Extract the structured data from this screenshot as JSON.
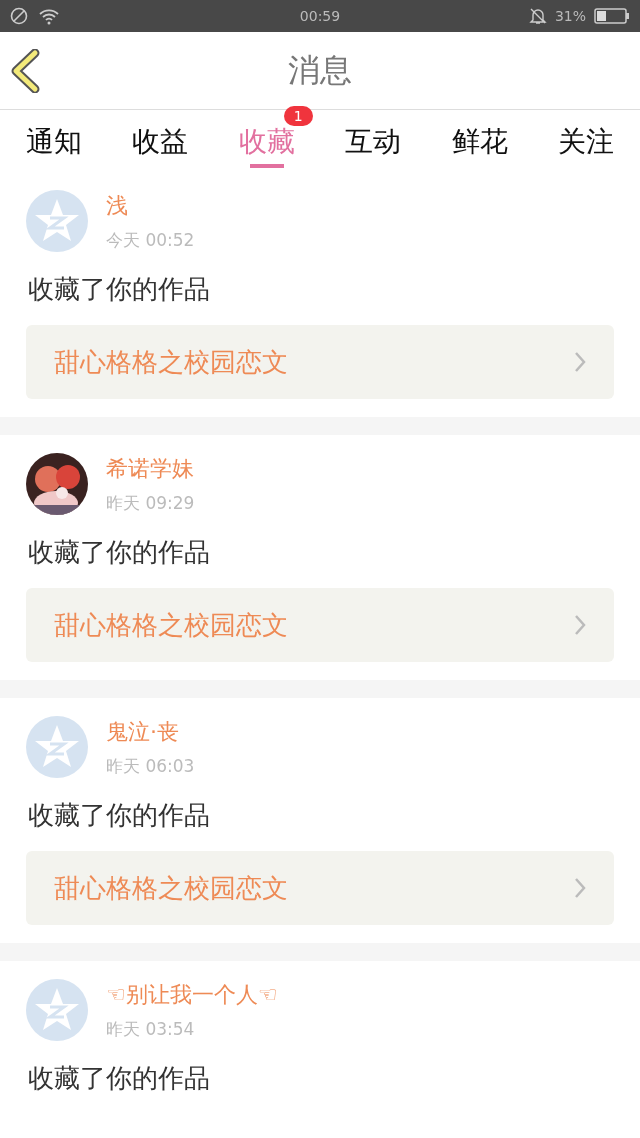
{
  "status_bar": {
    "time": "00:59",
    "battery": "31%"
  },
  "header": {
    "title": "消息"
  },
  "tabs": [
    {
      "label": "通知",
      "selected": false
    },
    {
      "label": "收益",
      "selected": false
    },
    {
      "label": "收藏",
      "selected": true,
      "badge": "1"
    },
    {
      "label": "互动",
      "selected": false
    },
    {
      "label": "鲜花",
      "selected": false
    },
    {
      "label": "关注",
      "selected": false
    }
  ],
  "messages": [
    {
      "name": "浅",
      "time": "今天 00:52",
      "kind": "default",
      "text": "收藏了你的作品",
      "work": "甜心格格之校园恋文"
    },
    {
      "name": "希诺学妹",
      "time": "昨天 09:29",
      "kind": "picture",
      "text": "收藏了你的作品",
      "work": "甜心格格之校园恋文"
    },
    {
      "name": "鬼泣·丧",
      "time": "昨天 06:03",
      "kind": "default",
      "text": "收藏了你的作品",
      "work": "甜心格格之校园恋文"
    },
    {
      "name": "☜别让我一个人☜",
      "time": "昨天 03:54",
      "kind": "default",
      "text": "收藏了你的作品"
    }
  ]
}
